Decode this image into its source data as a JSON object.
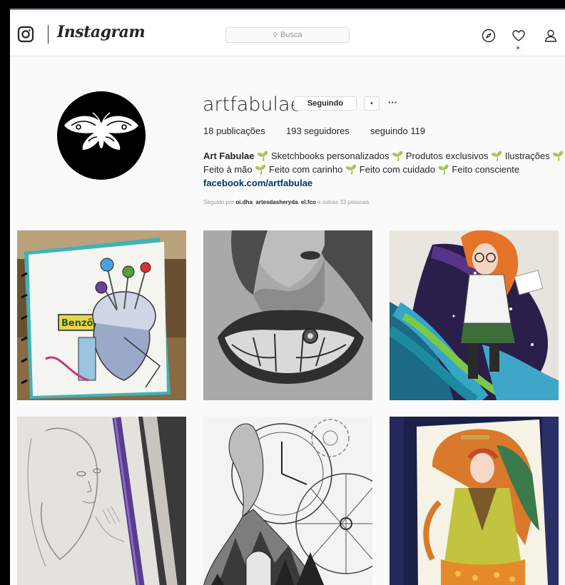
{
  "app": {
    "brand": "Instagram"
  },
  "search": {
    "placeholder": "Busca"
  },
  "profile": {
    "username": "artfabulae",
    "follow_button": "Seguindo",
    "dropdown_glyph": "▾",
    "more_glyph": "···",
    "stats": {
      "posts": "18 publicações",
      "followers": "193 seguidores",
      "following": "seguindo 119"
    },
    "bio": {
      "name": "Art Fabulae",
      "line1_rest": "Sketchbooks personalizados 🌱 Produtos exclusivos 🌱 Ilustrações 🌱",
      "line2": "Feito à mão 🌱 Feito com carinho 🌱 Feito com cuidado 🌱 Feito consciente",
      "link": "facebook.com/artfabulae",
      "sprout": "🌱"
    },
    "followed_by": {
      "prefix": "Seguido por",
      "users": [
        "oi.dha",
        "artesdasheryda",
        "el.fco"
      ],
      "suffix": "e outras 33 pessoas"
    }
  },
  "icons": {
    "logo": "instagram-glyph-icon",
    "explore": "compass-icon",
    "activity": "heart-icon",
    "profile": "person-icon",
    "search": "search-icon"
  },
  "colors": {
    "page_bg": "#fafafa",
    "link": "#003569",
    "notification": "#ed4956"
  },
  "posts": [
    {
      "label": "Benzô"
    },
    {},
    {},
    {},
    {},
    {}
  ]
}
